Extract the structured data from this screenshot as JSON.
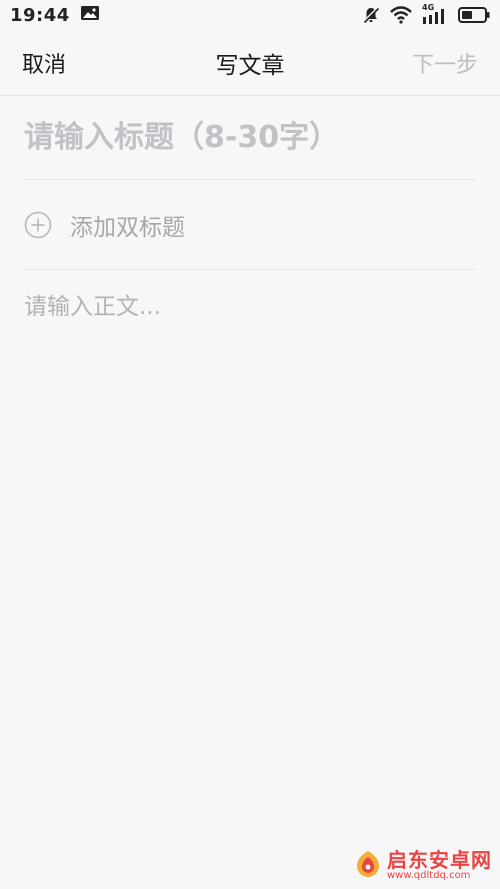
{
  "status_bar": {
    "time": "19:44",
    "network": "4G",
    "icons": [
      "image-icon",
      "mute-icon",
      "wifi-icon",
      "signal-icon",
      "battery-icon"
    ]
  },
  "nav": {
    "cancel": "取消",
    "title": "写文章",
    "next": "下一步"
  },
  "editor": {
    "title_placeholder": "请输入标题（8-30字）",
    "subtitle_label": "添加双标题",
    "body_placeholder": "请输入正文..."
  },
  "watermark": {
    "name": "启东安卓网",
    "url": "www.qdltdq.com"
  },
  "colors": {
    "background": "#f7f7f9",
    "text": "#1a1a1a",
    "disabled": "#bdbdbd",
    "placeholder": "#c2c2c6",
    "watermark": "#e8312e"
  }
}
